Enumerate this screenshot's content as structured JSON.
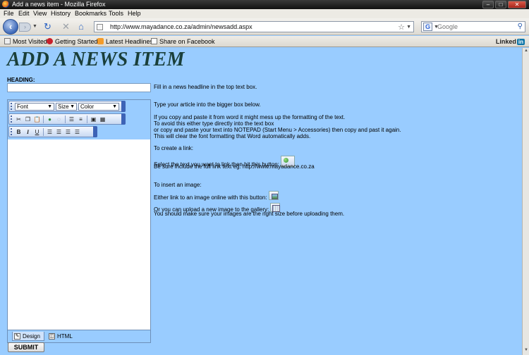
{
  "window": {
    "title": "Add a news item - Mozilla Firefox",
    "min_label": "–",
    "max_label": "□",
    "close_label": "✕"
  },
  "menu": [
    "File",
    "Edit",
    "View",
    "History",
    "Bookmarks",
    "Tools",
    "Help"
  ],
  "nav": {
    "url": "http://www.mayadance.co.za/admin/newsadd.aspx",
    "search_placeholder": "Google"
  },
  "bookmarks": {
    "items": [
      "Most Visited",
      "Getting Started",
      "Latest Headlines",
      "Share on Facebook"
    ],
    "linkedin": "Linked",
    "linkedin_in": "in"
  },
  "page": {
    "title": "ADD A NEWS ITEM",
    "heading_label": "HEADING:",
    "heading_value": "",
    "submit_label": "SUBMIT"
  },
  "editor": {
    "font_select": "Font",
    "size_select": "Size",
    "color_select": "Color",
    "tabs": [
      "Design",
      "HTML"
    ]
  },
  "help": {
    "line1": "Fill in a news headline in the top text box.",
    "line2": "Type your article into the bigger box below.",
    "para1": [
      "If you copy and paste it from word it might mess up the formatting of the text.",
      "To avoid this either type directly into the text box",
      "or copy and paste your text into NOTEPAD (Start Menu > Accessories) then copy and past it again.",
      "This will clear the font formatting that Word automatically adds."
    ],
    "link_title": "To create a link:",
    "link_line1": "Select the text you want to link then hit this button:",
    "link_line2": "Be sure include the full link text eg: http://www.mayadance.co.za",
    "image_title": "To insert an image:",
    "image_line1": "Either link to an image online with this button:",
    "image_line2": "Or you can upload a new image to the gallery:",
    "image_line3": "You should make sure your images are the right size before uploading them."
  }
}
